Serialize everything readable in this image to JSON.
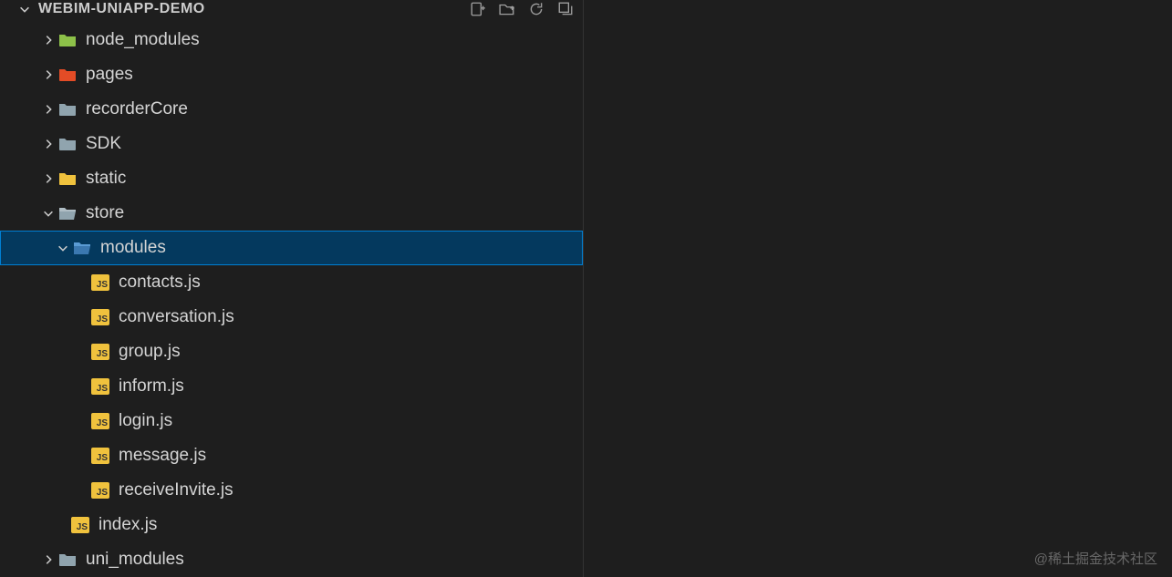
{
  "projectTitle": "WEBIM-UNIAPP-DEMO",
  "tree": {
    "node_modules": "node_modules",
    "pages": "pages",
    "recorderCore": "recorderCore",
    "SDK": "SDK",
    "static": "static",
    "store": "store",
    "modules": "modules",
    "contacts": "contacts.js",
    "conversation": "conversation.js",
    "group": "group.js",
    "inform": "inform.js",
    "login": "login.js",
    "message": "message.js",
    "receiveInvite": "receiveInvite.js",
    "index": "index.js",
    "uni_modules": "uni_modules"
  },
  "jsBadge": "JS",
  "watermark": "@稀土掘金技术社区"
}
